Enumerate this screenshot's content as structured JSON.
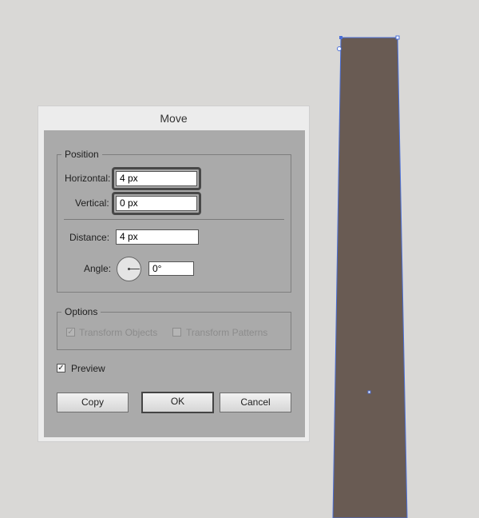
{
  "dialog": {
    "title": "Move",
    "position": {
      "legend": "Position",
      "horizontal_label": "Horizontal:",
      "horizontal_value": "4 px",
      "vertical_label": "Vertical:",
      "vertical_value": "0 px",
      "distance_label": "Distance:",
      "distance_value": "4 px",
      "angle_label": "Angle:",
      "angle_value": "0°"
    },
    "options": {
      "legend": "Options",
      "transform_objects": {
        "label": "Transform Objects",
        "checked": true,
        "enabled": false
      },
      "transform_patterns": {
        "label": "Transform Patterns",
        "checked": false,
        "enabled": false
      }
    },
    "preview": {
      "label": "Preview",
      "checked": true
    },
    "buttons": {
      "copy": "Copy",
      "ok": "OK",
      "cancel": "Cancel"
    }
  },
  "canvas": {
    "shape_fill": "#695b53",
    "selection_color": "#4a6fd8"
  }
}
